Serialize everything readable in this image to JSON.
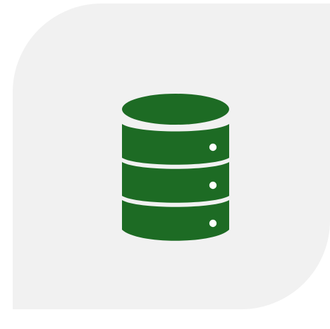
{
  "tile": {
    "background": "#f1f1f1"
  },
  "icon": {
    "name": "database-icon",
    "color": "#1d6b24",
    "indicator_color": "#ffffff"
  }
}
